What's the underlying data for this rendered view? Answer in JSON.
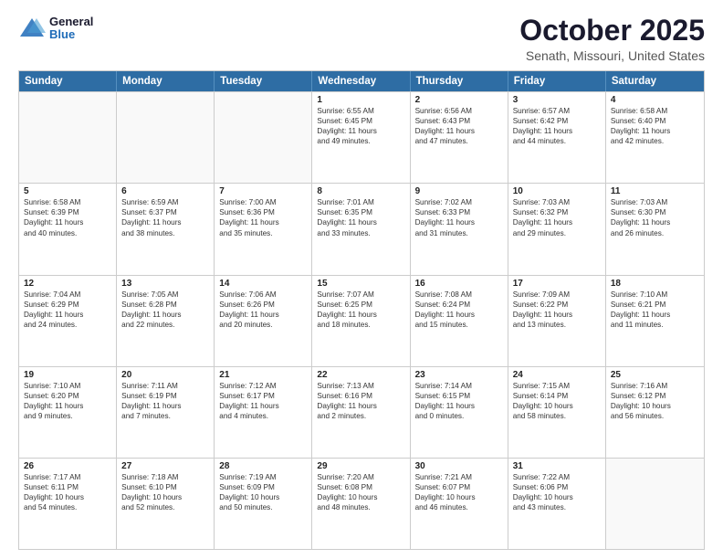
{
  "logo": {
    "general": "General",
    "blue": "Blue"
  },
  "title": "October 2025",
  "location": "Senath, Missouri, United States",
  "days_of_week": [
    "Sunday",
    "Monday",
    "Tuesday",
    "Wednesday",
    "Thursday",
    "Friday",
    "Saturday"
  ],
  "weeks": [
    [
      {
        "day": "",
        "text": ""
      },
      {
        "day": "",
        "text": ""
      },
      {
        "day": "",
        "text": ""
      },
      {
        "day": "1",
        "text": "Sunrise: 6:55 AM\nSunset: 6:45 PM\nDaylight: 11 hours\nand 49 minutes."
      },
      {
        "day": "2",
        "text": "Sunrise: 6:56 AM\nSunset: 6:43 PM\nDaylight: 11 hours\nand 47 minutes."
      },
      {
        "day": "3",
        "text": "Sunrise: 6:57 AM\nSunset: 6:42 PM\nDaylight: 11 hours\nand 44 minutes."
      },
      {
        "day": "4",
        "text": "Sunrise: 6:58 AM\nSunset: 6:40 PM\nDaylight: 11 hours\nand 42 minutes."
      }
    ],
    [
      {
        "day": "5",
        "text": "Sunrise: 6:58 AM\nSunset: 6:39 PM\nDaylight: 11 hours\nand 40 minutes."
      },
      {
        "day": "6",
        "text": "Sunrise: 6:59 AM\nSunset: 6:37 PM\nDaylight: 11 hours\nand 38 minutes."
      },
      {
        "day": "7",
        "text": "Sunrise: 7:00 AM\nSunset: 6:36 PM\nDaylight: 11 hours\nand 35 minutes."
      },
      {
        "day": "8",
        "text": "Sunrise: 7:01 AM\nSunset: 6:35 PM\nDaylight: 11 hours\nand 33 minutes."
      },
      {
        "day": "9",
        "text": "Sunrise: 7:02 AM\nSunset: 6:33 PM\nDaylight: 11 hours\nand 31 minutes."
      },
      {
        "day": "10",
        "text": "Sunrise: 7:03 AM\nSunset: 6:32 PM\nDaylight: 11 hours\nand 29 minutes."
      },
      {
        "day": "11",
        "text": "Sunrise: 7:03 AM\nSunset: 6:30 PM\nDaylight: 11 hours\nand 26 minutes."
      }
    ],
    [
      {
        "day": "12",
        "text": "Sunrise: 7:04 AM\nSunset: 6:29 PM\nDaylight: 11 hours\nand 24 minutes."
      },
      {
        "day": "13",
        "text": "Sunrise: 7:05 AM\nSunset: 6:28 PM\nDaylight: 11 hours\nand 22 minutes."
      },
      {
        "day": "14",
        "text": "Sunrise: 7:06 AM\nSunset: 6:26 PM\nDaylight: 11 hours\nand 20 minutes."
      },
      {
        "day": "15",
        "text": "Sunrise: 7:07 AM\nSunset: 6:25 PM\nDaylight: 11 hours\nand 18 minutes."
      },
      {
        "day": "16",
        "text": "Sunrise: 7:08 AM\nSunset: 6:24 PM\nDaylight: 11 hours\nand 15 minutes."
      },
      {
        "day": "17",
        "text": "Sunrise: 7:09 AM\nSunset: 6:22 PM\nDaylight: 11 hours\nand 13 minutes."
      },
      {
        "day": "18",
        "text": "Sunrise: 7:10 AM\nSunset: 6:21 PM\nDaylight: 11 hours\nand 11 minutes."
      }
    ],
    [
      {
        "day": "19",
        "text": "Sunrise: 7:10 AM\nSunset: 6:20 PM\nDaylight: 11 hours\nand 9 minutes."
      },
      {
        "day": "20",
        "text": "Sunrise: 7:11 AM\nSunset: 6:19 PM\nDaylight: 11 hours\nand 7 minutes."
      },
      {
        "day": "21",
        "text": "Sunrise: 7:12 AM\nSunset: 6:17 PM\nDaylight: 11 hours\nand 4 minutes."
      },
      {
        "day": "22",
        "text": "Sunrise: 7:13 AM\nSunset: 6:16 PM\nDaylight: 11 hours\nand 2 minutes."
      },
      {
        "day": "23",
        "text": "Sunrise: 7:14 AM\nSunset: 6:15 PM\nDaylight: 11 hours\nand 0 minutes."
      },
      {
        "day": "24",
        "text": "Sunrise: 7:15 AM\nSunset: 6:14 PM\nDaylight: 10 hours\nand 58 minutes."
      },
      {
        "day": "25",
        "text": "Sunrise: 7:16 AM\nSunset: 6:12 PM\nDaylight: 10 hours\nand 56 minutes."
      }
    ],
    [
      {
        "day": "26",
        "text": "Sunrise: 7:17 AM\nSunset: 6:11 PM\nDaylight: 10 hours\nand 54 minutes."
      },
      {
        "day": "27",
        "text": "Sunrise: 7:18 AM\nSunset: 6:10 PM\nDaylight: 10 hours\nand 52 minutes."
      },
      {
        "day": "28",
        "text": "Sunrise: 7:19 AM\nSunset: 6:09 PM\nDaylight: 10 hours\nand 50 minutes."
      },
      {
        "day": "29",
        "text": "Sunrise: 7:20 AM\nSunset: 6:08 PM\nDaylight: 10 hours\nand 48 minutes."
      },
      {
        "day": "30",
        "text": "Sunrise: 7:21 AM\nSunset: 6:07 PM\nDaylight: 10 hours\nand 46 minutes."
      },
      {
        "day": "31",
        "text": "Sunrise: 7:22 AM\nSunset: 6:06 PM\nDaylight: 10 hours\nand 43 minutes."
      },
      {
        "day": "",
        "text": ""
      }
    ]
  ]
}
